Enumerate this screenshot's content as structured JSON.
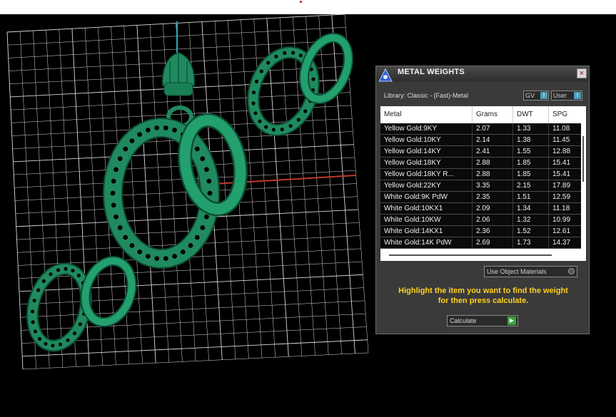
{
  "viewport": {
    "grid_color": "#d8d8d8",
    "model_color": "#1f8a5f",
    "axis_x_color": "#c0392b",
    "axis_y_color": "#2aa8b8"
  },
  "panel": {
    "title": "METAL WEIGHTS",
    "close_label": "×",
    "library_label": "Library: Classic - (Fast)-Metal",
    "toggle_gv": "GV",
    "toggle_user": "User",
    "columns": [
      "Metal",
      "Grams",
      "DWT",
      "SPG"
    ],
    "rows": [
      [
        "Yellow Gold:9KY",
        "2.07",
        "1.33",
        "11.08"
      ],
      [
        "Yellow Gold:10KY",
        "2.14",
        "1.38",
        "11.45"
      ],
      [
        "Yellow Gold:14KY",
        "2.41",
        "1.55",
        "12.88"
      ],
      [
        "Yellow Gold:18KY",
        "2.88",
        "1.85",
        "15.41"
      ],
      [
        "Yellow Gold:18KY R...",
        "2.88",
        "1.85",
        "15.41"
      ],
      [
        "Yellow Gold:22KY",
        "3.35",
        "2.15",
        "17.89"
      ],
      [
        "White Gold:9K PdW",
        "2.35",
        "1.51",
        "12.59"
      ],
      [
        "White Gold:10KX1",
        "2.09",
        "1.34",
        "11.18"
      ],
      [
        "White Gold:10KW",
        "2.06",
        "1.32",
        "10.99"
      ],
      [
        "White Gold:14KX1",
        "2.36",
        "1.52",
        "12.61"
      ],
      [
        "White Gold:14K PdW",
        "2.69",
        "1.73",
        "14.37"
      ]
    ],
    "use_object_materials": "Use Object Materials",
    "hint_line1": "Highlight the item you want to find the weight",
    "hint_line2": "for then press calculate.",
    "calculate_label": "Calculate",
    "accent_color": "#ffd21f"
  }
}
